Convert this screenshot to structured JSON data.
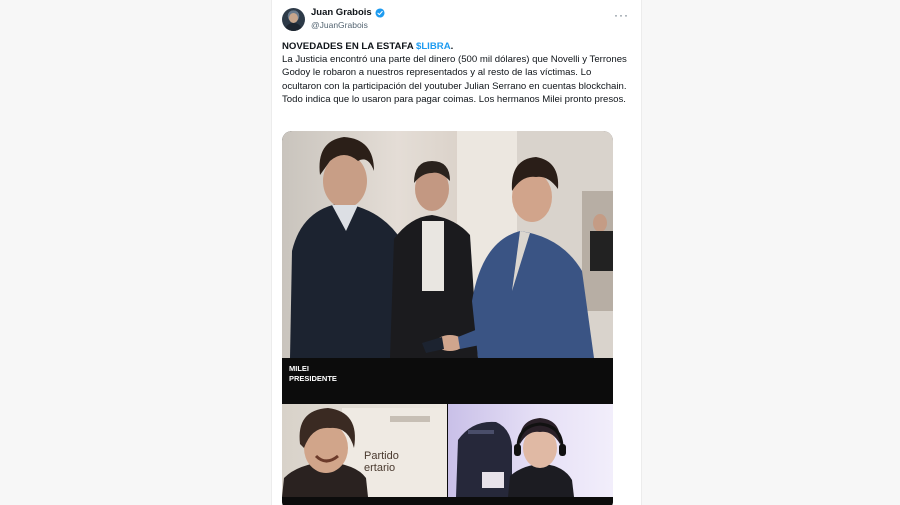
{
  "tweet": {
    "author_name": "Juan Grabois",
    "author_handle": "@JuanGrabois",
    "more_label": "···",
    "headline": "NOVEDADES EN LA ESTAFA",
    "hashtag": "$LIBRA",
    "headline_end": ".",
    "body": "La Justicia encontró una parte del dinero (500 mil dólares) que Novelli y Terrones Godoy le robaron a nuestros representados y al resto de las víctimas. Lo ocultaron con la participación del youtuber Julian Serrano en cuentas blockchain. Todo indica que lo usaron para pagar coimas. Los hermanos Milei pronto presos."
  },
  "media": {
    "banner_line1": "MILEI",
    "banner_line2": "PRESIDENTE",
    "party_line1": "Partido",
    "party_line2": "ertario"
  },
  "colors": {
    "hashtag": "#1d9bf0",
    "verified": "#1d9bf0",
    "text": "#0f1419",
    "secondary": "#536471"
  },
  "icons": [
    "verified-badge-icon",
    "more-options-icon"
  ]
}
